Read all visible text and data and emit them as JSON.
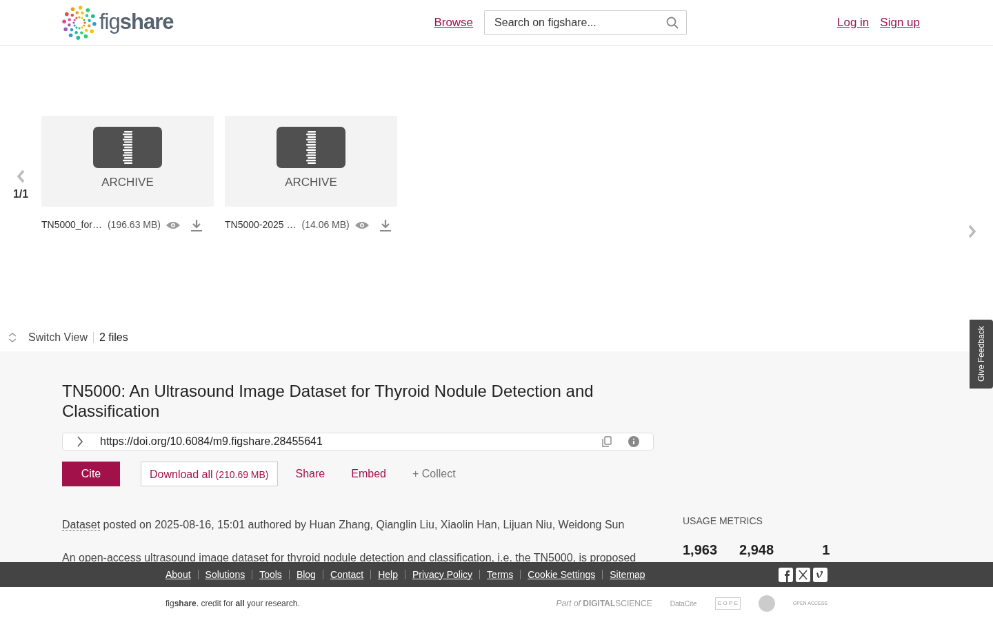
{
  "header": {
    "logo": "fig**share**",
    "nav_link": "Browse",
    "search": {
      "placeholder": "Search on figshare..."
    },
    "auth_links": [
      "Log in",
      "Sign up"
    ]
  },
  "carousel": {
    "page": "1/1",
    "files": [
      {
        "type_label": "ARCHIVE",
        "name": "TN5000_for…",
        "size": "(196.63 MB)"
      },
      {
        "type_label": "ARCHIVE",
        "name": "TN5000-2025 …",
        "size": "(14.06 MB)"
      }
    ]
  },
  "feedback_tab": "Give Feedback",
  "view_bar": {
    "switch_view": "Switch View",
    "file_count": "2 files"
  },
  "item": {
    "title": "TN5000: An Ultrasound Image Dataset for Thyroid Nodule Detection and Classification",
    "doi": "https://doi.org/10.6084/m9.figshare.28455641",
    "actions": [
      {
        "kind": "primary",
        "label": "Cite"
      },
      {
        "kind": "outline",
        "label": "Download all",
        "extra": "(210.69 MB)"
      },
      {
        "kind": "link",
        "label": "Share"
      },
      {
        "kind": "link",
        "label": "Embed"
      },
      {
        "kind": "muted",
        "label": "+ Collect"
      }
    ],
    "type_link": "Dataset",
    "posted": "posted on 2025-08-16, 15:01 authored by Huan Zhang, Qianglin Liu, Xiaolin Han, Lijuan Niu, Weidong Sun",
    "description": "An open-access ultrasound image dataset for thyroid nodule detection and classification, i.e. the TN5000, is proposed"
  },
  "metrics": {
    "heading": "USAGE METRICS",
    "values": [
      "1,963",
      "2,948",
      "1"
    ]
  },
  "footer": {
    "links": [
      "About",
      "Solutions",
      "Tools",
      "Blog",
      "Contact",
      "Help",
      "Privacy Policy",
      "Terms",
      "Cookie Settings",
      "Sitemap"
    ],
    "tagline": "fig**share**. credit for **all** your research.",
    "partners": [
      {
        "kind": "digital",
        "prefix": "Part of",
        "name": "DIGITAL",
        "name2": "SCIENCE"
      },
      {
        "kind": "datacite",
        "name": "DataCite"
      },
      {
        "kind": "cope",
        "name": "C O P E"
      },
      {
        "kind": "seal"
      },
      {
        "kind": "oa",
        "name": "OPEN",
        "name2": "ACCESS"
      }
    ]
  }
}
